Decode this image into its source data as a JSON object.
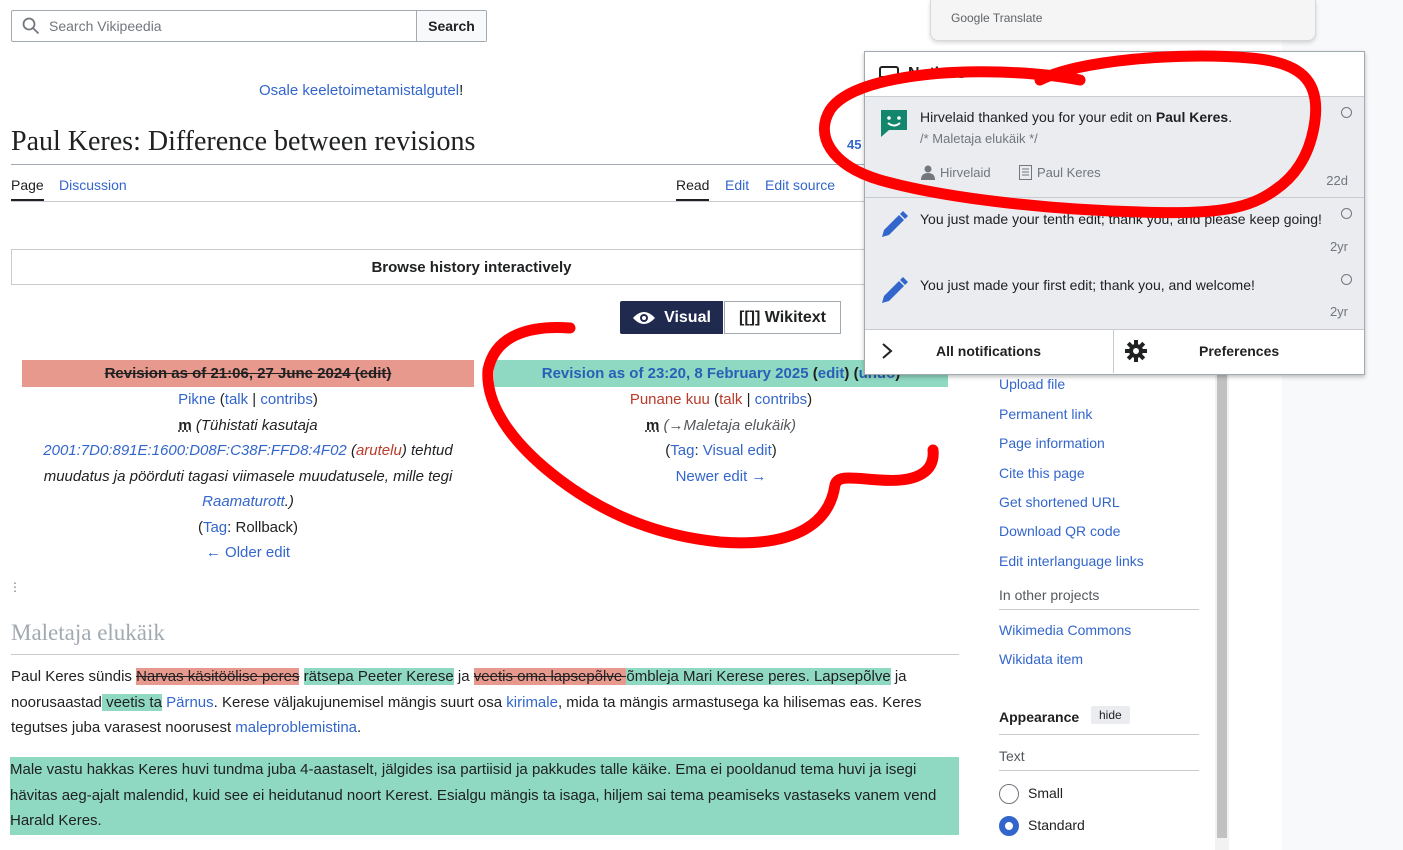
{
  "search": {
    "placeholder": "Search Vikipeedia",
    "button": "Search"
  },
  "sitenotice": {
    "link": "Osale keeletoimetamistalgutel",
    "suffix": "!"
  },
  "page": {
    "title": "Paul Keres: Difference between revisions",
    "rev_count_fragment": "45"
  },
  "tabs": {
    "page": "Page",
    "discussion": "Discussion",
    "read": "Read",
    "edit": "Edit",
    "edit_source": "Edit source"
  },
  "browse": "Browse history interactively",
  "diff_toggle": {
    "visual": "Visual",
    "wikitext": "[[]] Wikitext"
  },
  "old_revision": {
    "header": "Revision as of 21:06, 27 June 2024 (edit)",
    "user": "Pikne",
    "talk": "talk",
    "contribs": "contribs",
    "minor": "m",
    "summary_pre": "(Tühistati kasutaja",
    "ip": "2001:7D0:891E:1600:D08F:C38F:FFD8:4F02",
    "ip_talk": "arutelu",
    "summary_mid": "tehtud muudatus ja pöörduti tagasi viimasele muudatusele, mille tegi",
    "summary_user": "Raamaturott",
    "summary_end": ".)",
    "tag_label": "Tag",
    "tag": "Rollback",
    "nav": "← Older edit"
  },
  "new_revision": {
    "header_link": "Revision as of 23:20, 8 February 2025",
    "edit": "edit",
    "undo": "undo",
    "user": "Punane kuu",
    "talk": "talk",
    "contribs": "contribs",
    "minor": "m",
    "summary": "(→Maletaja elukäik)",
    "tag_label": "Tag",
    "tag": "Visual edit",
    "nav": "Newer edit →"
  },
  "section_heading": "Maletaja elukäik",
  "paragraph1": {
    "t1": "Paul Keres sündis ",
    "del1": "Narvas käsitöölise peres",
    "ins1": "rätsepa Peeter Kerese",
    "t2": " ja ",
    "del2": "veetis oma lapsepõlve ",
    "ins2": "õmbleja Mari Kerese peres. Lapsepõlve",
    "t3": " ja noorusaastad",
    "ins3": " veetis ta",
    "link1": "Pärnus",
    "t4": ". Kerese väljakujunemisel mängis suurt osa ",
    "link2": "kirimale",
    "t5": ", mida ta mängis armastusega ka hilisemas eas. Keres tegutses juba varasest noorusest ",
    "link3": "maleproblemistina",
    "t6": "."
  },
  "paragraph2": "Male vastu hakkas Keres huvi tundma juba 4-aastaselt, jälgides isa partiisid ja pakkudes talle käike. Ema ei pooldanud tema huvi ja isegi hävitas aeg-ajalt malendid, kuid see ei heidutanud noort Kerest. Esialgu mängis ta isaga, hiljem sai tema peamiseks vastaseks vanem vend Harald Keres.",
  "sidebar": {
    "tools": [
      "Upload file",
      "Permanent link",
      "Page information",
      "Cite this page",
      "Get shortened URL",
      "Download QR code",
      "Edit interlanguage links"
    ],
    "other_projects_heading": "In other projects",
    "other_projects": [
      "Wikimedia Commons",
      "Wikidata item"
    ],
    "appearance_heading": "Appearance",
    "hide": "hide",
    "text_heading": "Text",
    "text_options": [
      "Small",
      "Standard"
    ],
    "selected": "Standard"
  },
  "google_translate": "Google Translate",
  "notices": {
    "title": "Notices",
    "items": [
      {
        "msg_pre": "Hirvelaid thanked you for your edit on ",
        "msg_bold": "Paul Keres",
        "msg_post": ".",
        "sub": "/* Maletaja elukäik */",
        "user": "Hirvelaid",
        "page": "Paul Keres",
        "age": "22d",
        "icon": "thanks-icon"
      },
      {
        "msg": "You just made your tenth edit; thank you, and please keep going!",
        "age": "2yr",
        "icon": "pencil-icon"
      },
      {
        "msg": "You just made your first edit; thank you, and welcome!",
        "age": "2yr",
        "icon": "pencil-icon"
      }
    ],
    "all": "All notifications",
    "preferences": "Preferences"
  },
  "colors": {
    "link": "#3366cc",
    "deleted_bg": "#e8998d",
    "inserted_bg": "#8fd9c2",
    "scribble": "#ff0000",
    "toggle_active": "#202a4f"
  }
}
